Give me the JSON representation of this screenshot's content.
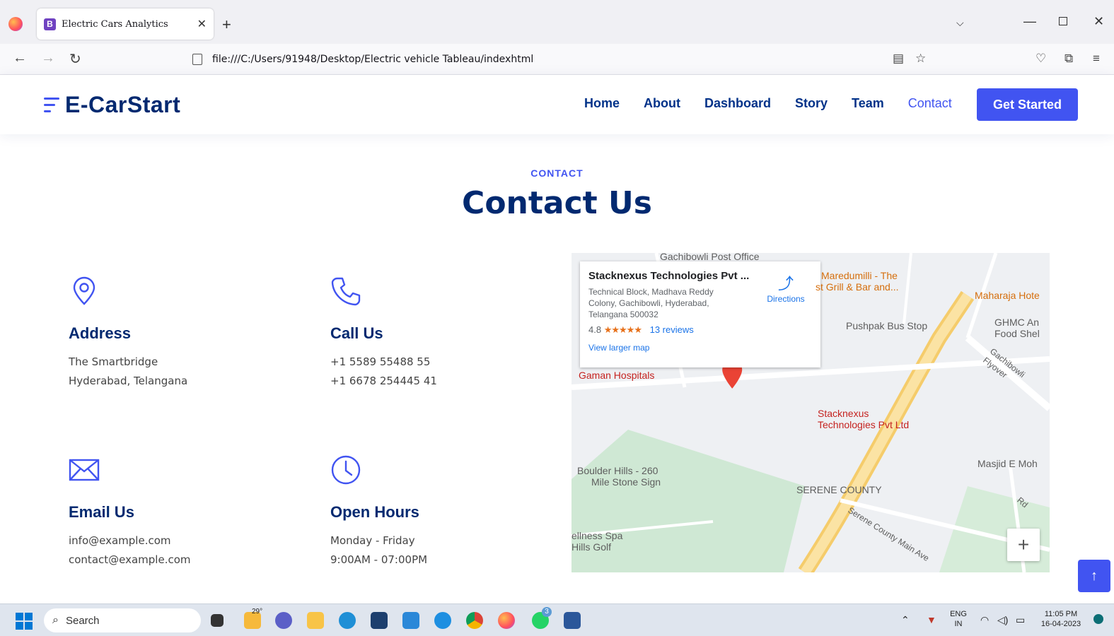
{
  "browser": {
    "tab_title": "Electric Cars Analytics",
    "tab_favicon": "B",
    "url": "file:///C:/Users/91948/Desktop/Electric vehicle Tableau/indexhtml"
  },
  "site": {
    "logo": "E-CarStart",
    "nav": [
      "Home",
      "About",
      "Dashboard",
      "Story",
      "Team",
      "Contact"
    ],
    "active_nav": "Contact",
    "cta": "Get Started",
    "brand_color": "#4154f1",
    "heading_color": "#012970"
  },
  "section": {
    "eyebrow": "CONTACT",
    "title": "Contact Us"
  },
  "info": {
    "address": {
      "title": "Address",
      "line1": "The Smartbridge",
      "line2": "Hyderabad, Telangana",
      "icon": "map-pin-icon"
    },
    "call": {
      "title": "Call Us",
      "line1": "+1 5589 55488 55",
      "line2": "+1 6678 254445 41",
      "icon": "phone-icon"
    },
    "email": {
      "title": "Email Us",
      "line1": "info@example.com",
      "line2": "contact@example.com",
      "icon": "envelope-icon"
    },
    "hours": {
      "title": "Open Hours",
      "line1": "Monday - Friday",
      "line2": "9:00AM - 07:00PM",
      "icon": "clock-icon"
    }
  },
  "map": {
    "place_name": "Stacknexus Technologies Pvt ...",
    "place_address": "Technical Block, Madhava Reddy Colony, Gachibowli, Hyderabad, Telangana 500032",
    "rating": "4.8",
    "stars": "★★★★★",
    "reviews": "13 reviews",
    "larger_map": "View larger map",
    "directions": "Directions",
    "labels": {
      "post_office": "Gachibowli Post Office",
      "maredumilli": "Maredumilli - The",
      "grill": "st Grill & Bar and...",
      "maharaja": "Maharaja Hote",
      "pushpak": "Pushpak Bus Stop",
      "ghmc1": "GHMC An",
      "ghmc2": "Food Shel",
      "flyover": "Gachibowli Flyover",
      "gaman": "Gaman Hospitals",
      "stacknexus1": "Stacknexus",
      "stacknexus2": "Technologies Pvt Ltd",
      "boulder1": "Boulder Hills - 260",
      "boulder2": "Mile Stone Sign",
      "serene": "SERENE COUNTY",
      "masjid": "Masjid E Moh",
      "wellness1": "ellness Spa",
      "wellness2": "Hills Golf",
      "serene_road": "Serene County Main Ave",
      "rd": "Rd"
    },
    "zoom_in": "+"
  },
  "taskbar": {
    "search": "Search",
    "temp": "29°",
    "lang1": "ENG",
    "lang2": "IN",
    "time": "11:05 PM",
    "date": "16-04-2023",
    "badge": "3"
  }
}
